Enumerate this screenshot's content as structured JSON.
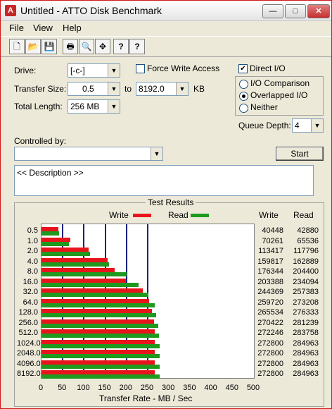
{
  "window": {
    "title": "Untitled - ATTO Disk Benchmark",
    "app_icon": "A",
    "minimize": "—",
    "maximize": "□",
    "close": "✕"
  },
  "menu": {
    "file": "File",
    "view": "View",
    "help": "Help"
  },
  "toolbar": {
    "icons": [
      "new-file-icon",
      "open-folder-icon",
      "save-icon",
      "print-icon",
      "print-preview-icon",
      "move-icon",
      "help-icon",
      "context-help-icon"
    ],
    "glyphs": [
      "🗋",
      "📂",
      "💾",
      "🖶",
      "🔍",
      "✥",
      "?",
      "?"
    ]
  },
  "settings": {
    "drive_label": "Drive:",
    "drive_value": "[-c-]",
    "transfer_size_label": "Transfer Size:",
    "transfer_from": "0.5",
    "to_label": "to",
    "transfer_to": "8192.0",
    "kb_label": "KB",
    "total_length_label": "Total Length:",
    "total_length_value": "256 MB",
    "force_write_access": "Force Write Access",
    "force_write_checked": false,
    "direct_io": "Direct I/O",
    "direct_io_checked": true,
    "io_comparison": "I/O Comparison",
    "overlapped_io": "Overlapped I/O",
    "neither": "Neither",
    "selected_mode": "overlapped_io",
    "queue_depth_label": "Queue Depth:",
    "queue_depth_value": "4",
    "controlled_by_label": "Controlled by:",
    "controlled_by_value": "",
    "start_label": "Start",
    "description": "<< Description >>"
  },
  "results": {
    "title": "Test Results",
    "legend_write": "Write",
    "legend_read": "Read",
    "col_write": "Write",
    "col_read": "Read",
    "axis_title": "Transfer Rate - MB / Sec",
    "x_ticks": [
      "0",
      "50",
      "100",
      "150",
      "200",
      "250",
      "300",
      "350",
      "400",
      "450",
      "500"
    ]
  },
  "colors": {
    "write": "#e8141c",
    "read": "#1f9a1f",
    "grid": "#1a237e"
  },
  "chart_data": {
    "type": "bar",
    "orientation": "horizontal",
    "xlim": [
      0,
      500
    ],
    "xlabel": "Transfer Rate - MB / Sec",
    "categories": [
      "0.5",
      "1.0",
      "2.0",
      "4.0",
      "8.0",
      "16.0",
      "32.0",
      "64.0",
      "128.0",
      "256.0",
      "512.0",
      "1024.0",
      "2048.0",
      "4096.0",
      "8192.0"
    ],
    "series": [
      {
        "name": "Write",
        "values_kb": [
          40448,
          70261,
          113417,
          159817,
          176344,
          203388,
          244369,
          259720,
          265534,
          270422,
          272246,
          272800,
          272800,
          272800,
          272800
        ]
      },
      {
        "name": "Read",
        "values_kb": [
          42880,
          65536,
          117796,
          162889,
          204400,
          234094,
          257383,
          273208,
          276333,
          281239,
          283758,
          284963,
          284963,
          284963,
          284963
        ]
      }
    ]
  }
}
